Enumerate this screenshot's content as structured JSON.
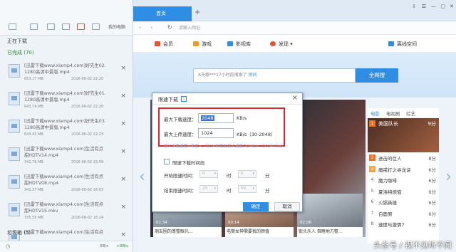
{
  "left_panel": {
    "my_cloud_label": "我的电脑",
    "downloading_label": "正在下载",
    "completed_label": "已完成 (70)",
    "items": [
      {
        "name": "[迅雷下载www.xiamp4.com]好先生02.\n1280高清中景版.mp4",
        "size": "653.17 MB",
        "date": "2016-06-02 22:20"
      },
      {
        "name": "[迅雷下载www.xiamp4.com]好先生01.\n1280高清中景版.mp4",
        "size": "643.74 MB",
        "date": "2016-06-02 22:20"
      },
      {
        "name": "[迅雷下载www.xiamp4.com]好先生03.\n1280高清中景版.mp4",
        "size": "643.45 MB",
        "date": "2016-06-02 22:23"
      },
      {
        "name": "[迅雷下载www.xiamp4.com]生活有点\n甜HDTV14.mp4",
        "size": "341.76 MB",
        "date": "2016-06-02 15:59"
      },
      {
        "name": "[迅雷下载www.xiamp4.com]生活有点\n甜HDTV08.mp4",
        "size": "341.37 MB",
        "date": "2016-06-02 16:03"
      },
      {
        "name": "[迅雷下载www.xiamp4.com]生活有点\n甜HDTV15.mkv",
        "size": "335.55 MB",
        "date": "2016-06-02 16:14"
      },
      {
        "name": "[迅雷下载www.xiamp4.com]生活有点",
        "size": "",
        "date": ""
      }
    ],
    "trash_label": "垃圾箱 (5)",
    "speed_down": "0B/s",
    "speed_up": "+0B/s"
  },
  "browser": {
    "tab_home": "首页",
    "address_placeholder": "请输入网址",
    "menu": [
      {
        "label": "会员",
        "color": "#e8532a"
      },
      {
        "label": "游戏",
        "color": "#f09a26"
      },
      {
        "label": "影视库",
        "color": "#2f8de4"
      },
      {
        "label": "发现",
        "color": "#e8532a"
      },
      {
        "label": "离线空间",
        "color": "#2f8de4"
      }
    ],
    "search_text": "A先跟***17小时前搜索了",
    "search_link": "房间",
    "search_button": "全网搜"
  },
  "thumbs": [
    {
      "time": "01:34",
      "caption": "朋友圈的蓬整眼光…"
    },
    {
      "time": "00:14",
      "caption": "电樊女神需要我的颜值"
    },
    {
      "time": "02:06",
      "caption": "街头乐人 目睹地方整…"
    }
  ],
  "ranking": {
    "tabs": [
      "电影",
      "电视剧",
      "综艺"
    ],
    "items": [
      {
        "rank": "1",
        "name": "美国队长",
        "score": "9分"
      },
      {
        "rank": "2",
        "name": "进击的巨人",
        "score": "8分"
      },
      {
        "rank": "3",
        "name": "魔戒打之寻龙诀",
        "score": "6分"
      },
      {
        "rank": "4",
        "name": "魔力咖啡",
        "score": "6分"
      },
      {
        "rank": "5",
        "name": "夏洛特烦恼",
        "score": "6分"
      },
      {
        "rank": "6",
        "name": "火锅英雄",
        "score": "6分"
      },
      {
        "rank": "7",
        "name": "白鹿原",
        "score": "6分"
      },
      {
        "rank": "8",
        "name": "速度与激情7",
        "score": "6分"
      }
    ]
  },
  "dialog": {
    "title": "限速下载",
    "max_down_label": "最大下载速度：",
    "max_down_value": "2048",
    "max_down_unit": "KB/s",
    "max_up_label": "最大上传速度：",
    "max_up_value": "1024",
    "max_up_unit": "KB/s（30-2048）",
    "hint": "最大下载速度=带宽×，如1M带宽的最大速度为1MB/s（1024KB/s）",
    "timed_label": "限速下载时间段",
    "start_label": "开始限速时间：",
    "end_label": "结束限速时间：",
    "start_hour": "0",
    "start_min": "0",
    "end_hour": "23",
    "end_min": "59",
    "hour_unit": "时",
    "min_unit": "分",
    "ok": "确定",
    "cancel": "取消"
  },
  "watermark": "头条号 / 视不见听不闻"
}
